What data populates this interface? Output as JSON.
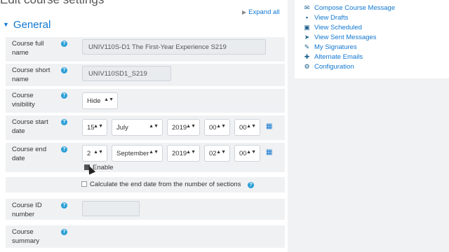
{
  "page": {
    "heading": "Edit course settings",
    "expand_all": "Expand all",
    "section_title": "General"
  },
  "form": {
    "fullname": {
      "label": "Course full name",
      "value": "UNIV110S-D1 The First-Year Experience  S219"
    },
    "shortname": {
      "label": "Course short name",
      "value": "UNIV110SD1_S219"
    },
    "visibility": {
      "label": "Course visibility",
      "value": "Hide"
    },
    "startdate": {
      "label": "Course start date",
      "day": "15",
      "month": "July",
      "year": "2019",
      "hour": "00",
      "minute": "00"
    },
    "enddate": {
      "label": "Course end date",
      "day": "2",
      "month": "September",
      "year": "2019",
      "hour": "02",
      "minute": "00",
      "enable_label": "Enable"
    },
    "calc_end": {
      "label": "Calculate the end date from the number of sections"
    },
    "idnumber": {
      "label": "Course ID number",
      "value": ""
    },
    "summary": {
      "label": "Course summary"
    }
  },
  "sidebar": {
    "items": [
      {
        "label": "Compose Course Message",
        "icon": "envelope-icon"
      },
      {
        "label": "View Drafts",
        "icon": "draft-icon"
      },
      {
        "label": "View Scheduled",
        "icon": "calendar-check-icon"
      },
      {
        "label": "View Sent Messages",
        "icon": "send-icon"
      },
      {
        "label": "My Signatures",
        "icon": "pencil-icon"
      },
      {
        "label": "Alternate Emails",
        "icon": "plus-icon"
      },
      {
        "label": "Configuration",
        "icon": "gear-icon"
      }
    ]
  },
  "colors": {
    "link": "#1177d1",
    "help": "#2a9fd6",
    "row_bg": "#f0f1f3"
  }
}
